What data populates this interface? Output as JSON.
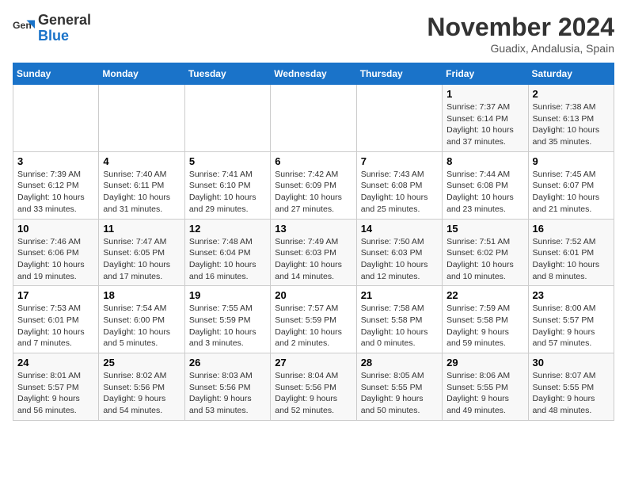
{
  "header": {
    "logo_line1": "General",
    "logo_line2": "Blue",
    "month": "November 2024",
    "location": "Guadix, Andalusia, Spain"
  },
  "weekdays": [
    "Sunday",
    "Monday",
    "Tuesday",
    "Wednesday",
    "Thursday",
    "Friday",
    "Saturday"
  ],
  "weeks": [
    [
      {
        "day": "",
        "info": ""
      },
      {
        "day": "",
        "info": ""
      },
      {
        "day": "",
        "info": ""
      },
      {
        "day": "",
        "info": ""
      },
      {
        "day": "",
        "info": ""
      },
      {
        "day": "1",
        "info": "Sunrise: 7:37 AM\nSunset: 6:14 PM\nDaylight: 10 hours and 37 minutes."
      },
      {
        "day": "2",
        "info": "Sunrise: 7:38 AM\nSunset: 6:13 PM\nDaylight: 10 hours and 35 minutes."
      }
    ],
    [
      {
        "day": "3",
        "info": "Sunrise: 7:39 AM\nSunset: 6:12 PM\nDaylight: 10 hours and 33 minutes."
      },
      {
        "day": "4",
        "info": "Sunrise: 7:40 AM\nSunset: 6:11 PM\nDaylight: 10 hours and 31 minutes."
      },
      {
        "day": "5",
        "info": "Sunrise: 7:41 AM\nSunset: 6:10 PM\nDaylight: 10 hours and 29 minutes."
      },
      {
        "day": "6",
        "info": "Sunrise: 7:42 AM\nSunset: 6:09 PM\nDaylight: 10 hours and 27 minutes."
      },
      {
        "day": "7",
        "info": "Sunrise: 7:43 AM\nSunset: 6:08 PM\nDaylight: 10 hours and 25 minutes."
      },
      {
        "day": "8",
        "info": "Sunrise: 7:44 AM\nSunset: 6:08 PM\nDaylight: 10 hours and 23 minutes."
      },
      {
        "day": "9",
        "info": "Sunrise: 7:45 AM\nSunset: 6:07 PM\nDaylight: 10 hours and 21 minutes."
      }
    ],
    [
      {
        "day": "10",
        "info": "Sunrise: 7:46 AM\nSunset: 6:06 PM\nDaylight: 10 hours and 19 minutes."
      },
      {
        "day": "11",
        "info": "Sunrise: 7:47 AM\nSunset: 6:05 PM\nDaylight: 10 hours and 17 minutes."
      },
      {
        "day": "12",
        "info": "Sunrise: 7:48 AM\nSunset: 6:04 PM\nDaylight: 10 hours and 16 minutes."
      },
      {
        "day": "13",
        "info": "Sunrise: 7:49 AM\nSunset: 6:03 PM\nDaylight: 10 hours and 14 minutes."
      },
      {
        "day": "14",
        "info": "Sunrise: 7:50 AM\nSunset: 6:03 PM\nDaylight: 10 hours and 12 minutes."
      },
      {
        "day": "15",
        "info": "Sunrise: 7:51 AM\nSunset: 6:02 PM\nDaylight: 10 hours and 10 minutes."
      },
      {
        "day": "16",
        "info": "Sunrise: 7:52 AM\nSunset: 6:01 PM\nDaylight: 10 hours and 8 minutes."
      }
    ],
    [
      {
        "day": "17",
        "info": "Sunrise: 7:53 AM\nSunset: 6:01 PM\nDaylight: 10 hours and 7 minutes."
      },
      {
        "day": "18",
        "info": "Sunrise: 7:54 AM\nSunset: 6:00 PM\nDaylight: 10 hours and 5 minutes."
      },
      {
        "day": "19",
        "info": "Sunrise: 7:55 AM\nSunset: 5:59 PM\nDaylight: 10 hours and 3 minutes."
      },
      {
        "day": "20",
        "info": "Sunrise: 7:57 AM\nSunset: 5:59 PM\nDaylight: 10 hours and 2 minutes."
      },
      {
        "day": "21",
        "info": "Sunrise: 7:58 AM\nSunset: 5:58 PM\nDaylight: 10 hours and 0 minutes."
      },
      {
        "day": "22",
        "info": "Sunrise: 7:59 AM\nSunset: 5:58 PM\nDaylight: 9 hours and 59 minutes."
      },
      {
        "day": "23",
        "info": "Sunrise: 8:00 AM\nSunset: 5:57 PM\nDaylight: 9 hours and 57 minutes."
      }
    ],
    [
      {
        "day": "24",
        "info": "Sunrise: 8:01 AM\nSunset: 5:57 PM\nDaylight: 9 hours and 56 minutes."
      },
      {
        "day": "25",
        "info": "Sunrise: 8:02 AM\nSunset: 5:56 PM\nDaylight: 9 hours and 54 minutes."
      },
      {
        "day": "26",
        "info": "Sunrise: 8:03 AM\nSunset: 5:56 PM\nDaylight: 9 hours and 53 minutes."
      },
      {
        "day": "27",
        "info": "Sunrise: 8:04 AM\nSunset: 5:56 PM\nDaylight: 9 hours and 52 minutes."
      },
      {
        "day": "28",
        "info": "Sunrise: 8:05 AM\nSunset: 5:55 PM\nDaylight: 9 hours and 50 minutes."
      },
      {
        "day": "29",
        "info": "Sunrise: 8:06 AM\nSunset: 5:55 PM\nDaylight: 9 hours and 49 minutes."
      },
      {
        "day": "30",
        "info": "Sunrise: 8:07 AM\nSunset: 5:55 PM\nDaylight: 9 hours and 48 minutes."
      }
    ]
  ]
}
